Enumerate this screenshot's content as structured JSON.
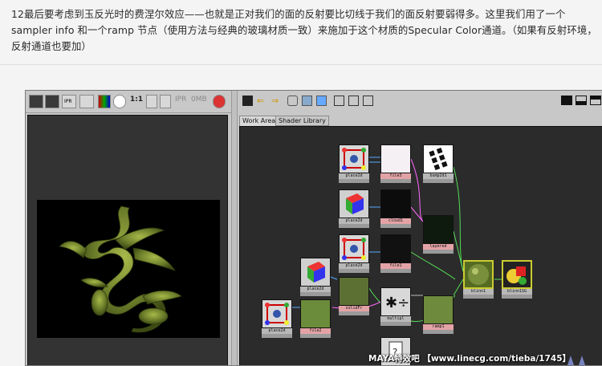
{
  "article": {
    "text": "12最后要考虑到玉反光时的费涅尔效应——也就是正对我们的面的反射要比切线于我们的面反射要弱得多。这里我们用了一个sampler info 和一个ramp 节点（使用方法与经典的玻璃材质一致）来施加于这个材质的Specular Color通道。（如果有反射环境，反射通道也要加）"
  },
  "render_view": {
    "ratio_label": "1:1",
    "ipr_label": "IPR",
    "ipr_dim_label": "IPR",
    "mem_label": "0MB"
  },
  "hypershade": {
    "tabs": [
      "Work Area",
      "Shader Library"
    ],
    "nodes": {
      "place2d_1": "place2d",
      "file3": "file3",
      "bump2d": "bump2d1",
      "place2d_2": "place2d",
      "cloud": "cloud1",
      "place2d_3": "place2d",
      "layered": "layered",
      "file1": "file1",
      "place2d_4": "place2d",
      "solidFr": "solidFr",
      "multipl": "multipl",
      "place2d_5": "place2d",
      "file2": "file2",
      "ramp": "ramp1",
      "blinn": "blinn1",
      "blinnSG": "blinn1SG",
      "sampler": "sampler"
    }
  },
  "watermark": "MAYA特效吧 【www.linecg.com/tieba/1745】",
  "colors": {
    "node_pink": "#e3a3a6",
    "graph_bg": "#2b2b2b",
    "ui_gray": "#c8c8c8"
  }
}
